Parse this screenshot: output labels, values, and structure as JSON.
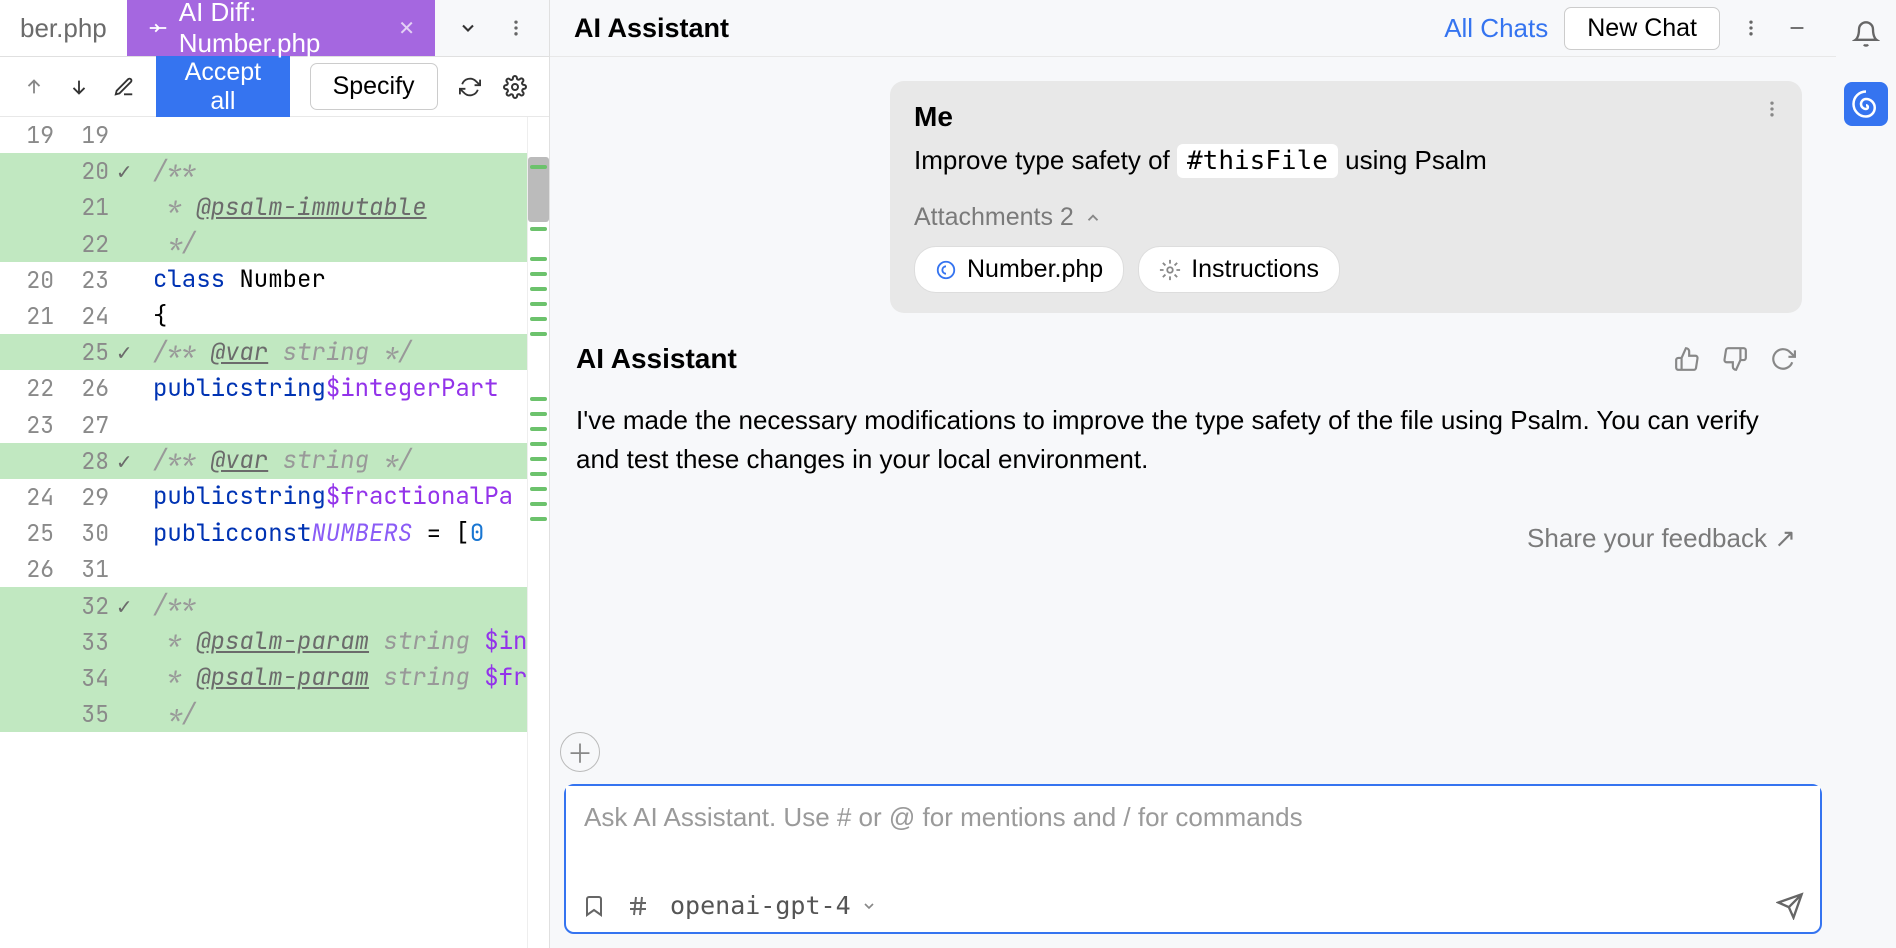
{
  "tabs": {
    "inactive_label": "ber.php",
    "active_label": "AI Diff: Number.php"
  },
  "toolbar": {
    "accept_all": "Accept all",
    "specify": "Specify"
  },
  "gutter": [
    {
      "l": "19",
      "r": "19",
      "added": false,
      "check": false
    },
    {
      "l": "",
      "r": "20",
      "added": true,
      "check": true
    },
    {
      "l": "",
      "r": "21",
      "added": true,
      "check": false
    },
    {
      "l": "",
      "r": "22",
      "added": true,
      "check": false
    },
    {
      "l": "20",
      "r": "23",
      "added": false,
      "check": false
    },
    {
      "l": "21",
      "r": "24",
      "added": false,
      "check": false
    },
    {
      "l": "",
      "r": "25",
      "added": true,
      "check": true
    },
    {
      "l": "22",
      "r": "26",
      "added": false,
      "check": false
    },
    {
      "l": "23",
      "r": "27",
      "added": false,
      "check": false
    },
    {
      "l": "",
      "r": "28",
      "added": true,
      "check": true
    },
    {
      "l": "24",
      "r": "29",
      "added": false,
      "check": false
    },
    {
      "l": "25",
      "r": "30",
      "added": false,
      "check": false
    },
    {
      "l": "26",
      "r": "31",
      "added": false,
      "check": false
    },
    {
      "l": "",
      "r": "32",
      "added": true,
      "check": true
    },
    {
      "l": "",
      "r": "33",
      "added": true,
      "check": false
    },
    {
      "l": "",
      "r": "34",
      "added": true,
      "check": false
    },
    {
      "l": "",
      "r": "35",
      "added": true,
      "check": false
    }
  ],
  "ai": {
    "title": "AI Assistant",
    "all_chats": "All Chats",
    "new_chat": "New Chat",
    "user": {
      "author": "Me",
      "prefix": "Improve type safety of ",
      "mention": "#thisFile",
      "suffix": " using Psalm",
      "attachments_label": "Attachments 2",
      "attach1": "Number.php",
      "attach2": "Instructions"
    },
    "assistant": {
      "author": "AI Assistant",
      "text": "I've made the necessary modifications to improve the type safety of the file using Psalm. You can verify and test these changes in your local environment."
    },
    "feedback": "Share your feedback",
    "placeholder": "Ask AI Assistant. Use # or @ for mentions and / for commands",
    "model": "openai-gpt-4"
  }
}
